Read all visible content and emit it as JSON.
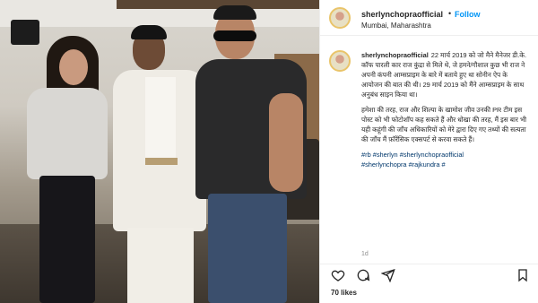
{
  "post": {
    "username": "sherlynchopraofficial",
    "follow_separator": "•",
    "follow_label": "Follow",
    "location": "Mumbai, Maharashtra",
    "caption": {
      "author": "sherlynchopraofficial",
      "paragraphs": [
        "22 मार्च 2019 को जो मैने मैनेजर डी.के. कॉफ पारली कार राज कुंद्रा से मिले थे, जे हमने/गौशाल कुछ भी राज ने अपनी कंपनी आम्सप्राइम के बारे में बताये हुए था सोनीन ऐप के आयोजन की बात की थी। 29 मार्च 2019 को मैंने आम्सप्राइम के साथ अनुबंध साइन किया था।",
        "हमेशा की तरह, राज और शिल्पा के खामोश जीव उनकी PR टीम इस पोस्ट को भी फोटोशॉप कह सकते हैं और धोखा की तरह, मैं इस बार भी यही कहूंगी की जाँच अधिकारियों को मेरे द्वारा दिए गए तथ्यों की सत्यता की जाँच मैं फ़ॉरेंसिक एक्सपर्ट से करवा सकते हैं।"
      ],
      "hashtags_line1": "#rb #sherlyn #sherlynchopraofficial",
      "hashtags_line2": "#sherlynchopra #rajkundra #"
    },
    "time": "1d",
    "likes": "70 likes"
  },
  "icons": {
    "like": "heart-icon",
    "comment": "comment-icon",
    "share": "share-icon",
    "save": "bookmark-icon"
  }
}
